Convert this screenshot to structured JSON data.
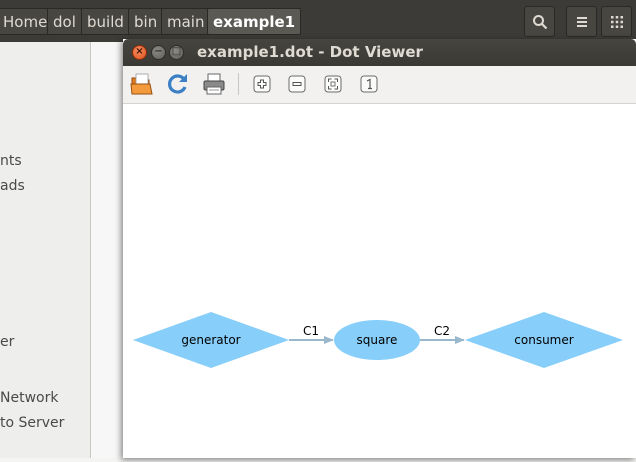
{
  "file_manager": {
    "breadcrumbs": [
      "Home",
      "dol",
      "build",
      "bin",
      "main",
      "example1"
    ],
    "sidebar_items": [
      "nts",
      "ads",
      "er",
      "Network",
      "to Server"
    ],
    "search_icon": "search-icon",
    "menu_icon": "hamburger-menu-icon",
    "grid_icon": "grid-view-icon"
  },
  "viewer": {
    "title": "example1.dot - Dot Viewer",
    "toolbar": [
      "open-icon",
      "reload-icon",
      "print-icon",
      "zoom-in-icon",
      "zoom-out-icon",
      "zoom-fit-icon",
      "zoom-100-icon"
    ],
    "graph": {
      "nodes": [
        {
          "id": "generator",
          "label": "generator",
          "shape": "diamond",
          "color": "#87cefa"
        },
        {
          "id": "square",
          "label": "square",
          "shape": "ellipse",
          "color": "#87cefa"
        },
        {
          "id": "consumer",
          "label": "consumer",
          "shape": "diamond",
          "color": "#87cefa"
        }
      ],
      "edges": [
        {
          "from": "generator",
          "to": "square",
          "label": "C1"
        },
        {
          "from": "square",
          "to": "consumer",
          "label": "C2"
        }
      ],
      "edge_color": "#9ab8cc"
    }
  },
  "colors": {
    "header": "#3c3b37",
    "close_button": "#e95420",
    "node_fill": "#87cefa"
  }
}
